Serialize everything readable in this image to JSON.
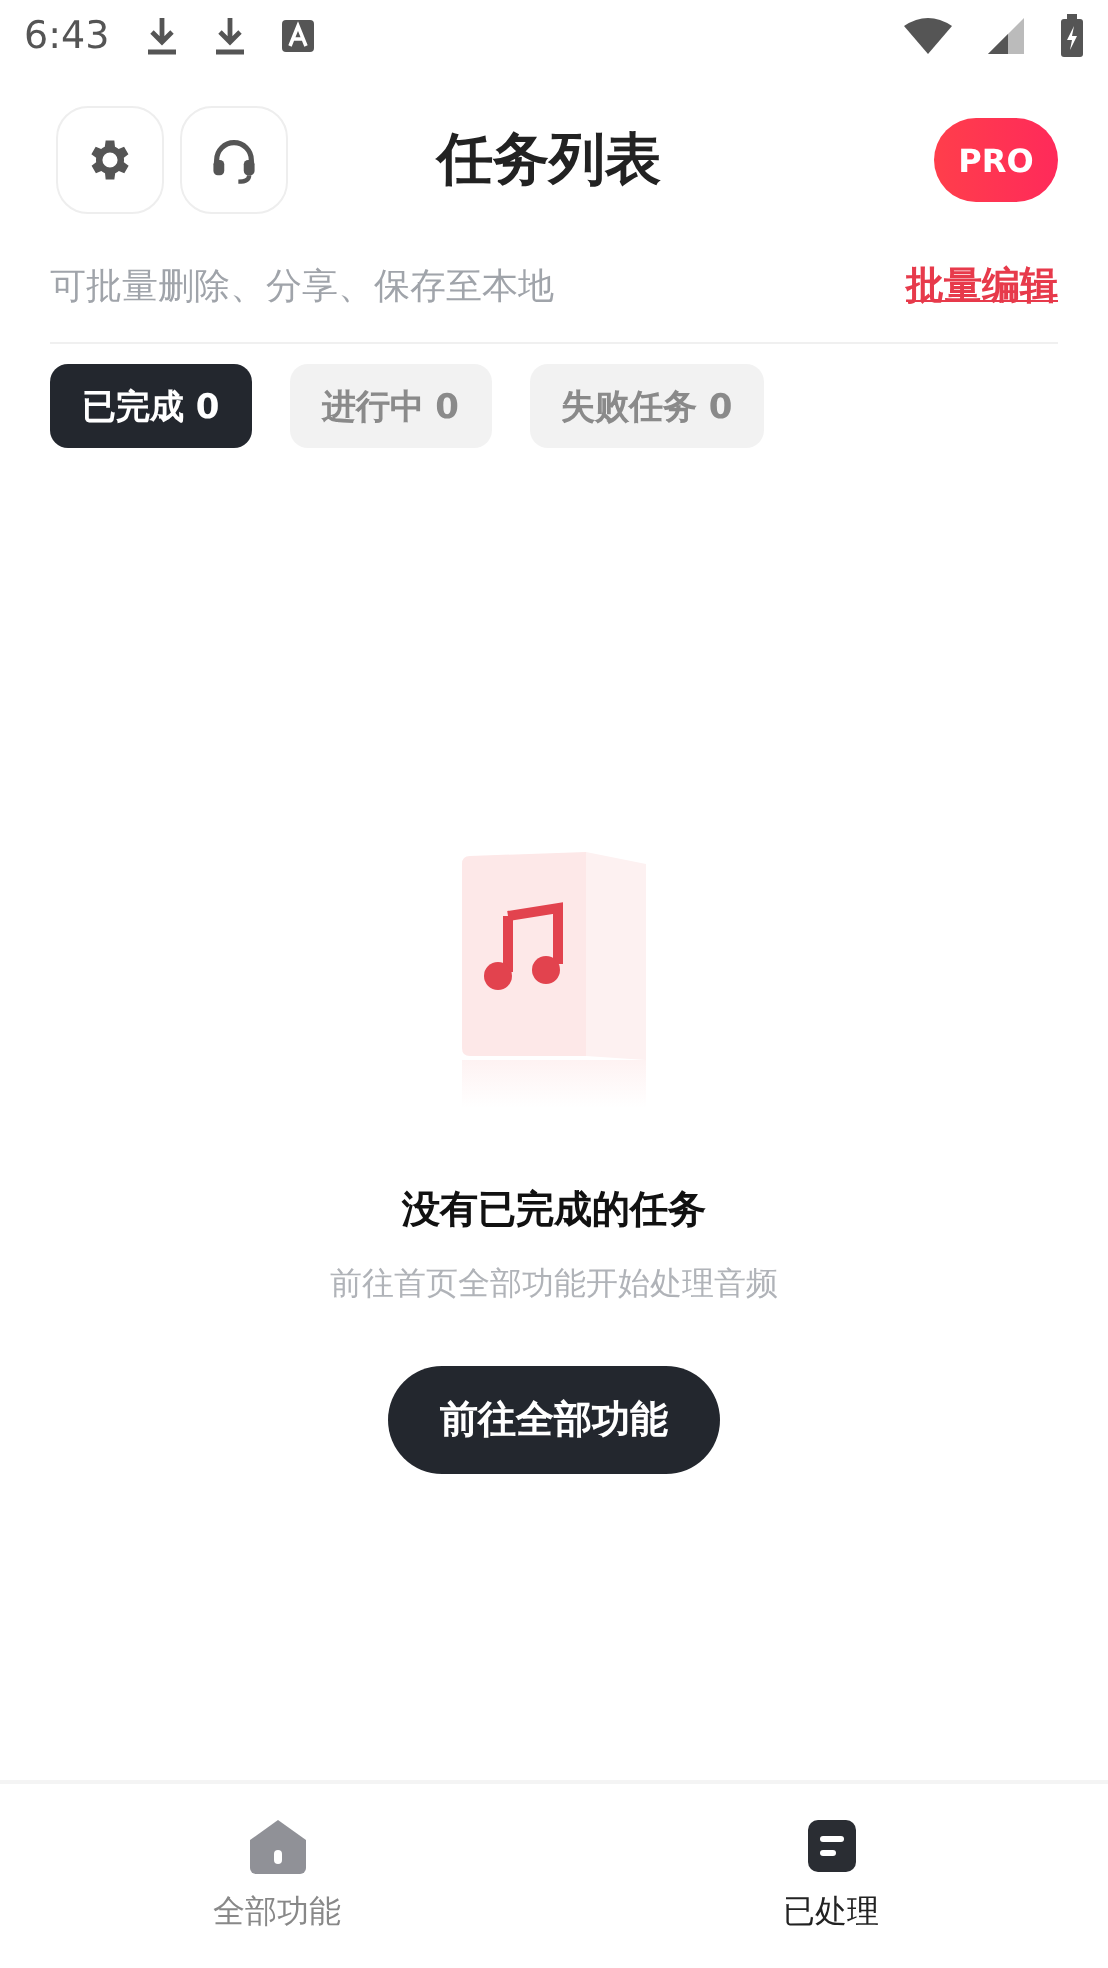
{
  "status_bar": {
    "time": "6:43"
  },
  "header": {
    "title": "任务列表",
    "pro_badge": "PRO"
  },
  "hint": {
    "text": "可批量删除、分享、保存至本地",
    "action": "批量编辑"
  },
  "filters": [
    {
      "label": "已完成 0",
      "selected": true
    },
    {
      "label": "进行中 0",
      "selected": false
    },
    {
      "label": "失败任务 0",
      "selected": false
    }
  ],
  "empty_state": {
    "title": "没有已完成的任务",
    "subtitle": "前往首页全部功能开始处理音频",
    "button": "前往全部功能"
  },
  "bottom_nav": [
    {
      "label": "全部功能",
      "kind": "home",
      "selected": false
    },
    {
      "label": "已处理",
      "kind": "list",
      "selected": true
    }
  ]
}
